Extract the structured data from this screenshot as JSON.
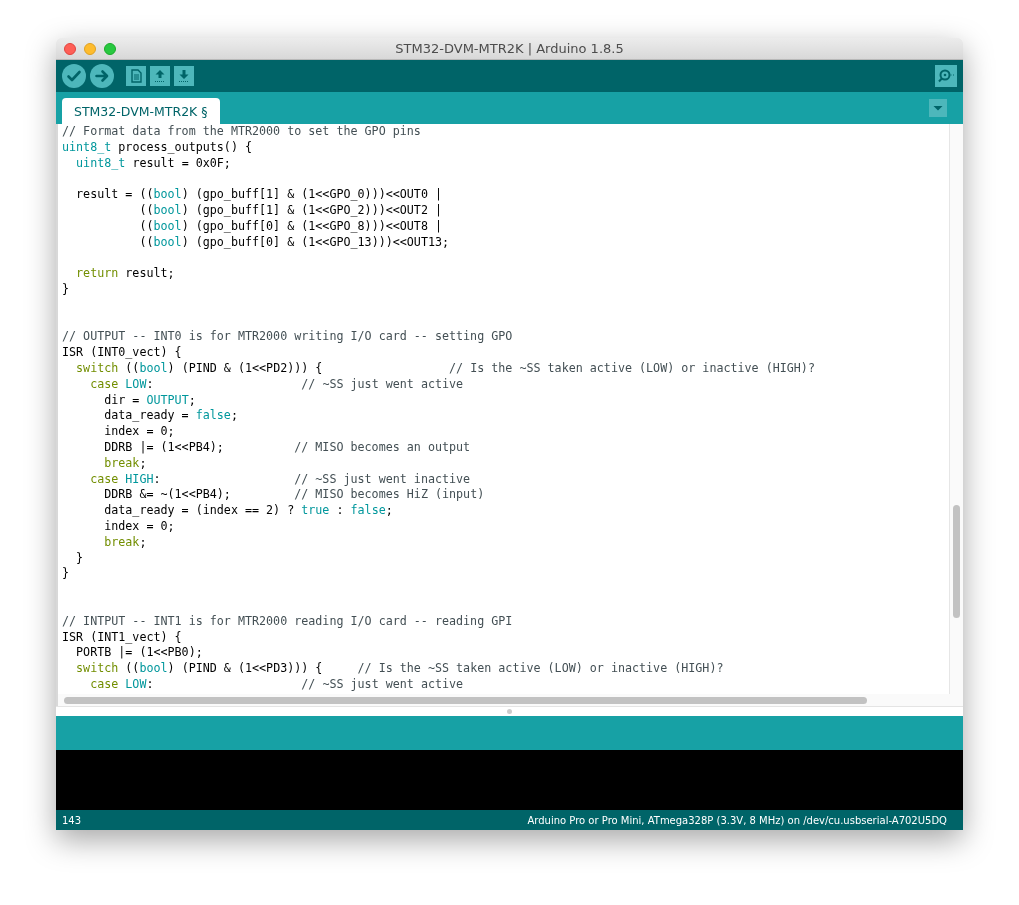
{
  "window": {
    "title": "STM32-DVM-MTR2K | Arduino 1.8.5"
  },
  "tabs": [
    {
      "label": "STM32-DVM-MTR2K §",
      "selected": true
    }
  ],
  "editor": {
    "lines": [
      {
        "kind": "code",
        "tokens": [
          {
            "text": "// Format data from the MTR2000 to set the GPO pins",
            "kind": "comment"
          }
        ]
      },
      {
        "kind": "code",
        "tokens": [
          {
            "text": "uint8_t",
            "kind": "type"
          },
          {
            "text": " process_outputs() {",
            "kind": "plain"
          }
        ]
      },
      {
        "kind": "code",
        "tokens": [
          {
            "text": "  uint8_t",
            "kind": "type"
          },
          {
            "text": " result = 0x0F;",
            "kind": "plain"
          }
        ]
      },
      {
        "kind": "blank"
      },
      {
        "kind": "code",
        "tokens": [
          {
            "text": "  result = ((",
            "kind": "plain"
          },
          {
            "text": "bool",
            "kind": "type"
          },
          {
            "text": ") (gpo_buff[1] & (1<<GPO_0)))<<OUT0 |",
            "kind": "plain"
          }
        ]
      },
      {
        "kind": "code",
        "tokens": [
          {
            "text": "           ((",
            "kind": "plain"
          },
          {
            "text": "bool",
            "kind": "type"
          },
          {
            "text": ") (gpo_buff[1] & (1<<GPO_2)))<<OUT2 |",
            "kind": "plain"
          }
        ]
      },
      {
        "kind": "code",
        "tokens": [
          {
            "text": "           ((",
            "kind": "plain"
          },
          {
            "text": "bool",
            "kind": "type"
          },
          {
            "text": ") (gpo_buff[0] & (1<<GPO_8)))<<OUT8 |",
            "kind": "plain"
          }
        ]
      },
      {
        "kind": "code",
        "tokens": [
          {
            "text": "           ((",
            "kind": "plain"
          },
          {
            "text": "bool",
            "kind": "type"
          },
          {
            "text": ") (gpo_buff[0] & (1<<GPO_13)))<<OUT13;",
            "kind": "plain"
          }
        ]
      },
      {
        "kind": "blank"
      },
      {
        "kind": "code",
        "tokens": [
          {
            "text": "  return",
            "kind": "keyword"
          },
          {
            "text": " result;",
            "kind": "plain"
          }
        ]
      },
      {
        "kind": "code",
        "tokens": [
          {
            "text": "}",
            "kind": "plain"
          }
        ]
      },
      {
        "kind": "blank"
      },
      {
        "kind": "blank"
      },
      {
        "kind": "code",
        "tokens": [
          {
            "text": "// OUTPUT -- INT0 is for MTR2000 writing I/O card -- setting GPO",
            "kind": "comment"
          }
        ]
      },
      {
        "kind": "code",
        "tokens": [
          {
            "text": "ISR (INT0_vect) {",
            "kind": "plain"
          }
        ]
      },
      {
        "kind": "code",
        "tokens": [
          {
            "text": "  switch",
            "kind": "keyword"
          },
          {
            "text": " ((",
            "kind": "plain"
          },
          {
            "text": "bool",
            "kind": "type"
          },
          {
            "text": ") (PIND & (1<<PD2))) {",
            "kind": "plain"
          },
          {
            "text": "                  // Is the ~SS taken active (LOW) or inactive (HIGH)?",
            "kind": "comment"
          }
        ]
      },
      {
        "kind": "code",
        "tokens": [
          {
            "text": "    case",
            "kind": "keyword"
          },
          {
            "text": " LOW",
            "kind": "type"
          },
          {
            "text": ":",
            "kind": "plain"
          },
          {
            "text": "                     // ~SS just went active",
            "kind": "comment"
          }
        ]
      },
      {
        "kind": "code",
        "tokens": [
          {
            "text": "      dir = ",
            "kind": "plain"
          },
          {
            "text": "OUTPUT",
            "kind": "type"
          },
          {
            "text": ";",
            "kind": "plain"
          }
        ]
      },
      {
        "kind": "code",
        "tokens": [
          {
            "text": "      data_ready = ",
            "kind": "plain"
          },
          {
            "text": "false",
            "kind": "type"
          },
          {
            "text": ";",
            "kind": "plain"
          }
        ]
      },
      {
        "kind": "code",
        "tokens": [
          {
            "text": "      index = 0;",
            "kind": "plain"
          }
        ]
      },
      {
        "kind": "code",
        "tokens": [
          {
            "text": "      DDRB |= (1<<PB4);",
            "kind": "plain"
          },
          {
            "text": "          // MISO becomes an output",
            "kind": "comment"
          }
        ]
      },
      {
        "kind": "code",
        "tokens": [
          {
            "text": "      break",
            "kind": "keyword"
          },
          {
            "text": ";",
            "kind": "plain"
          }
        ]
      },
      {
        "kind": "code",
        "tokens": [
          {
            "text": "    case",
            "kind": "keyword"
          },
          {
            "text": " HIGH",
            "kind": "type"
          },
          {
            "text": ":",
            "kind": "plain"
          },
          {
            "text": "                   // ~SS just went inactive",
            "kind": "comment"
          }
        ]
      },
      {
        "kind": "code",
        "tokens": [
          {
            "text": "      DDRB &= ~(1<<PB4);",
            "kind": "plain"
          },
          {
            "text": "         // MISO becomes HiZ (input)",
            "kind": "comment"
          }
        ]
      },
      {
        "kind": "code",
        "tokens": [
          {
            "text": "      data_ready = (index == 2) ? ",
            "kind": "plain"
          },
          {
            "text": "true",
            "kind": "type"
          },
          {
            "text": " : ",
            "kind": "plain"
          },
          {
            "text": "false",
            "kind": "type"
          },
          {
            "text": ";",
            "kind": "plain"
          }
        ]
      },
      {
        "kind": "code",
        "tokens": [
          {
            "text": "      index = 0;",
            "kind": "plain"
          }
        ]
      },
      {
        "kind": "code",
        "tokens": [
          {
            "text": "      break",
            "kind": "keyword"
          },
          {
            "text": ";",
            "kind": "plain"
          }
        ]
      },
      {
        "kind": "code",
        "tokens": [
          {
            "text": "  }",
            "kind": "plain"
          }
        ]
      },
      {
        "kind": "code",
        "tokens": [
          {
            "text": "}",
            "kind": "plain"
          }
        ]
      },
      {
        "kind": "blank"
      },
      {
        "kind": "blank"
      },
      {
        "kind": "code",
        "tokens": [
          {
            "text": "// INTPUT -- INT1 is for MTR2000 reading I/O card -- reading GPI",
            "kind": "comment"
          }
        ]
      },
      {
        "kind": "code",
        "tokens": [
          {
            "text": "ISR (INT1_vect) {",
            "kind": "plain"
          }
        ]
      },
      {
        "kind": "code",
        "tokens": [
          {
            "text": "  PORTB |= (1<<PB0);",
            "kind": "plain"
          }
        ]
      },
      {
        "kind": "code",
        "tokens": [
          {
            "text": "  switch",
            "kind": "keyword"
          },
          {
            "text": " ((",
            "kind": "plain"
          },
          {
            "text": "bool",
            "kind": "type"
          },
          {
            "text": ") (PIND & (1<<PD3))) {",
            "kind": "plain"
          },
          {
            "text": "     // Is the ~SS taken active (LOW) or inactive (HIGH)?",
            "kind": "comment"
          }
        ]
      },
      {
        "kind": "code",
        "tokens": [
          {
            "text": "    case",
            "kind": "keyword"
          },
          {
            "text": " LOW",
            "kind": "type"
          },
          {
            "text": ":",
            "kind": "plain"
          },
          {
            "text": "                     // ~SS just went active",
            "kind": "comment"
          }
        ]
      }
    ]
  },
  "status_bar": {
    "line": "143",
    "board": "Arduino Pro or Pro Mini, ATmega328P (3.3V, 8 MHz) on /dev/cu.usbserial-A702U5DQ"
  }
}
